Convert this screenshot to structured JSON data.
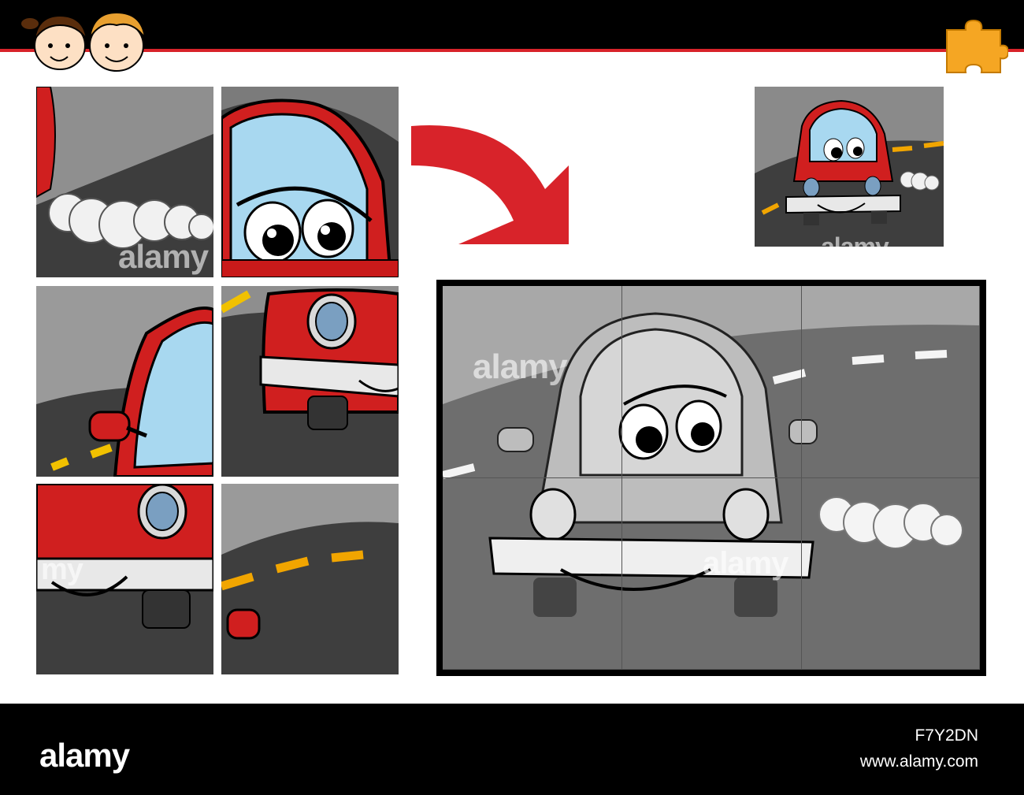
{
  "header": {
    "kids_logo_icon": "kids-faces-icon",
    "puzzle_icon": "puzzle-piece-icon",
    "colors": {
      "bar": "#000000",
      "accent_line": "#d8232a",
      "puzzle_piece": "#f5a623"
    }
  },
  "pieces": [
    {
      "id": "piece-1",
      "content": "exhaust-smoke",
      "watermark": "alamy"
    },
    {
      "id": "piece-2",
      "content": "car-eyes",
      "watermark": ""
    },
    {
      "id": "piece-3",
      "content": "car-side-mirror",
      "watermark": ""
    },
    {
      "id": "piece-4",
      "content": "car-headlight-right",
      "watermark": ""
    },
    {
      "id": "piece-5",
      "content": "car-headlight-left",
      "watermark": "my"
    },
    {
      "id": "piece-6",
      "content": "road-stripes",
      "watermark": ""
    }
  ],
  "arrow": {
    "icon": "curved-arrow-icon",
    "color": "#d8232a"
  },
  "preview": {
    "watermark": "alamy"
  },
  "board": {
    "rows": 2,
    "cols": 3,
    "watermarks": [
      "alamy",
      "alamy"
    ]
  },
  "footer": {
    "brand": "alamy",
    "image_id": "F7Y2DN",
    "url": "www.alamy.com"
  }
}
